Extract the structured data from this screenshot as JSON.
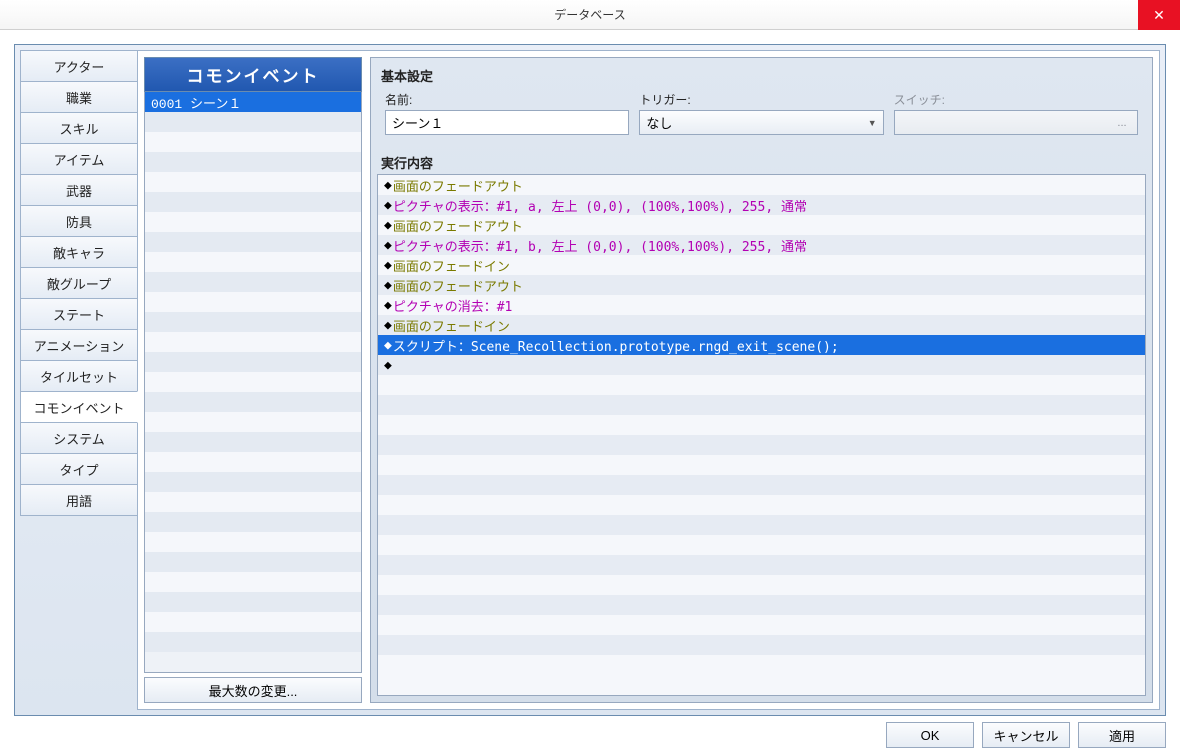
{
  "window": {
    "title": "データベース"
  },
  "tabs": {
    "items": [
      "アクター",
      "職業",
      "スキル",
      "アイテム",
      "武器",
      "防具",
      "敵キャラ",
      "敵グループ",
      "ステート",
      "アニメーション",
      "タイルセット",
      "コモンイベント",
      "システム",
      "タイプ",
      "用語"
    ],
    "activeIndex": 11
  },
  "sidebar": {
    "title": "コモンイベント",
    "items": [
      "0001 シーン１"
    ],
    "selectedIndex": 0,
    "maxChangeLabel": "最大数の変更..."
  },
  "basic": {
    "title": "基本設定",
    "nameLabel": "名前:",
    "nameValue": "シーン１",
    "triggerLabel": "トリガー:",
    "triggerValue": "なし",
    "switchLabel": "スイッチ:",
    "switchValue": "",
    "switchChooser": "..."
  },
  "exec": {
    "title": "実行内容",
    "commands": [
      {
        "kind": "olive",
        "text": "画面のフェードアウト",
        "sel": false
      },
      {
        "kind": "magenta",
        "text": "ピクチャの表示：#1, a, 左上 (0,0), (100%,100%), 255, 通常",
        "sel": false
      },
      {
        "kind": "olive",
        "text": "画面のフェードアウト",
        "sel": false
      },
      {
        "kind": "magenta",
        "text": "ピクチャの表示：#1, b, 左上 (0,0), (100%,100%), 255, 通常",
        "sel": false
      },
      {
        "kind": "olive",
        "text": "画面のフェードイン",
        "sel": false
      },
      {
        "kind": "olive",
        "text": "画面のフェードアウト",
        "sel": false
      },
      {
        "kind": "magenta",
        "text": "ピクチャの消去：#1",
        "sel": false
      },
      {
        "kind": "olive",
        "text": "画面のフェードイン",
        "sel": false
      },
      {
        "kind": "script",
        "text": "スクリプト：Scene_Recollection.prototype.rngd_exit_scene();",
        "sel": true
      },
      {
        "kind": "blank",
        "text": "",
        "sel": false
      }
    ]
  },
  "buttons": {
    "ok": "OK",
    "cancel": "キャンセル",
    "apply": "適用"
  }
}
